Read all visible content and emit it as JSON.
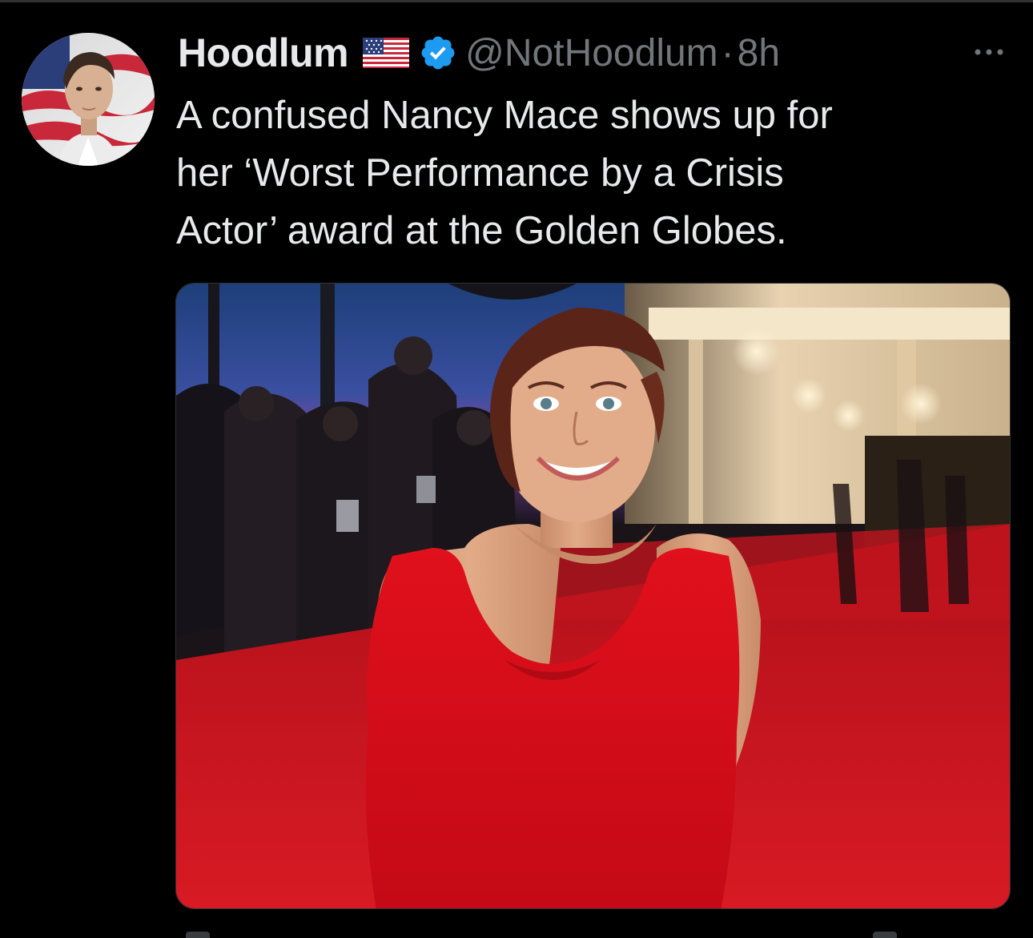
{
  "tweet": {
    "author": {
      "display_name": "Hoodlum",
      "handle": "@NotHoodlum",
      "flag": "us-flag-icon",
      "verified": true
    },
    "separator": "·",
    "timestamp": "8h",
    "text_lines": [
      "A confused Nancy Mace shows up for",
      "her ‘Worst Performance by a Crisis",
      "Actor’ award at the Golden Globes."
    ],
    "more_icon": "more-icon"
  },
  "colors": {
    "background": "#000000",
    "text_primary": "#e7e9ea",
    "text_secondary": "#71767b",
    "verified_badge": "#1d9bf0",
    "divider": "#2f3336"
  }
}
